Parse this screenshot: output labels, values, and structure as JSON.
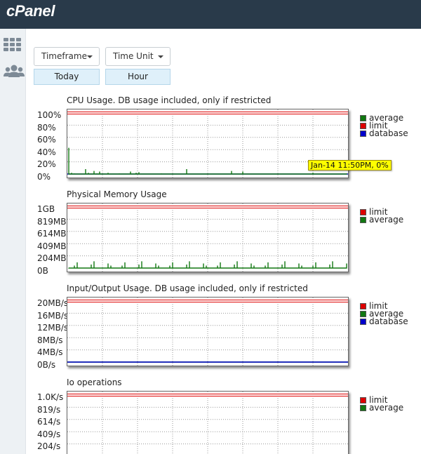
{
  "app": {
    "logo": "cPanel"
  },
  "sidebar": {
    "items": [
      {
        "icon": "grid-icon"
      },
      {
        "icon": "users-icon"
      }
    ]
  },
  "controls": {
    "timeframe_label": "Timeframe",
    "timeunit_label": "Time Unit",
    "timeframe_value": "Today",
    "timeunit_value": "Hour"
  },
  "colors": {
    "limit": "#dd0000",
    "average": "#117711",
    "database": "#0000cc",
    "topbar": "#293a4a"
  },
  "charts": [
    {
      "title": "CPU Usage. DB usage included, only if restricted",
      "yticks": [
        "100%",
        "80%",
        "60%",
        "40%",
        "20%",
        "0%"
      ],
      "legend": [
        {
          "label": "average",
          "color": "#117711"
        },
        {
          "label": "limit",
          "color": "#dd0000"
        },
        {
          "label": "database",
          "color": "#0000cc"
        }
      ]
    },
    {
      "title": "Physical Memory Usage",
      "yticks": [
        "1GB",
        "819MB",
        "614MB",
        "409MB",
        "204MB",
        "0B"
      ],
      "legend": [
        {
          "label": "limit",
          "color": "#dd0000"
        },
        {
          "label": "average",
          "color": "#117711"
        }
      ]
    },
    {
      "title": "Input/Output Usage. DB usage included, only if restricted",
      "yticks": [
        "20MB/s",
        "16MB/s",
        "12MB/s",
        "8MB/s",
        "4MB/s",
        "0B/s"
      ],
      "legend": [
        {
          "label": "limit",
          "color": "#dd0000"
        },
        {
          "label": "average",
          "color": "#117711"
        },
        {
          "label": "database",
          "color": "#0000cc"
        }
      ]
    },
    {
      "title": "Io operations",
      "yticks": [
        "1.0K/s",
        "819/s",
        "614/s",
        "409/s",
        "204/s"
      ],
      "legend": [
        {
          "label": "limit",
          "color": "#dd0000"
        },
        {
          "label": "average",
          "color": "#117711"
        }
      ]
    }
  ],
  "tooltip": {
    "text": "Jan-14 11:50PM, 0%"
  },
  "chart_data": [
    {
      "type": "line",
      "title": "CPU Usage. DB usage included, only if restricted",
      "ylim": [
        0,
        100
      ],
      "x_count": 100,
      "series": [
        {
          "name": "limit",
          "color": "#dd0000",
          "values": [
            100
          ]
        },
        {
          "name": "average",
          "color": "#117711",
          "values": [
            43,
            2,
            1,
            0,
            0,
            0,
            8,
            2,
            0,
            5,
            1,
            4,
            0,
            0,
            2,
            0,
            0,
            0,
            1,
            0,
            0,
            0,
            4,
            0,
            2,
            3,
            0,
            0,
            0,
            0,
            0,
            0,
            0,
            1,
            0,
            0,
            0,
            0,
            0,
            0,
            0,
            0,
            8,
            0,
            0,
            0,
            0,
            0,
            0,
            0,
            0,
            0,
            0,
            0,
            0,
            0,
            0,
            0,
            5,
            0,
            0,
            0,
            4,
            0,
            0,
            0,
            0,
            0,
            0,
            0,
            0,
            0,
            0,
            0,
            0,
            0,
            0,
            0,
            0,
            0,
            0,
            0,
            0,
            0,
            0,
            0,
            0,
            2,
            0,
            0,
            0,
            0,
            0,
            0,
            0,
            0,
            0,
            0,
            0,
            1
          ]
        },
        {
          "name": "database",
          "color": "#0000cc",
          "values": [
            0
          ]
        }
      ]
    },
    {
      "type": "line",
      "title": "Physical Memory Usage",
      "ylim": [
        0,
        1
      ],
      "units": "GB",
      "series": [
        {
          "name": "limit",
          "color": "#dd0000",
          "values": [
            1
          ]
        },
        {
          "name": "average",
          "color": "#117711",
          "values": [
            0.08
          ]
        }
      ]
    },
    {
      "type": "line",
      "title": "Input/Output Usage. DB usage included, only if restricted",
      "ylim": [
        0,
        20
      ],
      "units": "MB/s",
      "series": [
        {
          "name": "limit",
          "color": "#dd0000",
          "values": [
            20
          ]
        },
        {
          "name": "average",
          "color": "#117711",
          "values": [
            0
          ]
        },
        {
          "name": "database",
          "color": "#0000cc",
          "values": [
            0
          ]
        }
      ]
    },
    {
      "type": "line",
      "title": "Io operations",
      "ylim": [
        0,
        1024
      ],
      "units": "/s",
      "series": [
        {
          "name": "limit",
          "color": "#dd0000",
          "values": [
            1024
          ]
        },
        {
          "name": "average",
          "color": "#117711",
          "values": [
            0
          ]
        }
      ]
    }
  ]
}
